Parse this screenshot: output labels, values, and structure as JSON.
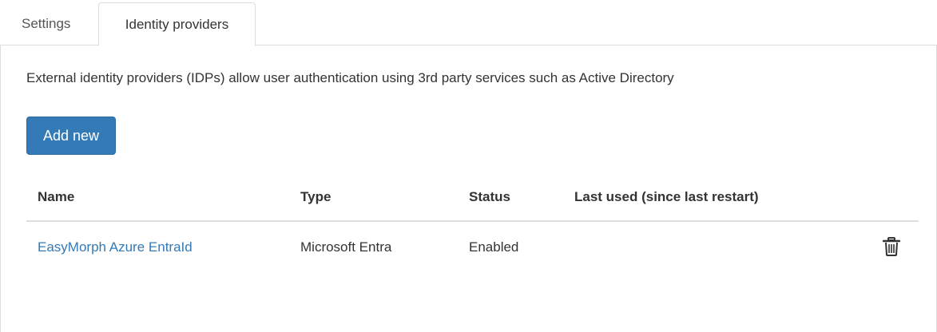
{
  "tabs": [
    {
      "label": "Settings",
      "active": false
    },
    {
      "label": "Identity providers",
      "active": true
    }
  ],
  "panel": {
    "description": "External identity providers (IDPs) allow user authentication using 3rd party services such as Active Directory",
    "add_button_label": "Add new",
    "accent_color": "#337ab7"
  },
  "table": {
    "columns": [
      "Name",
      "Type",
      "Status",
      "Last used (since last restart)"
    ],
    "rows": [
      {
        "name": "EasyMorph Azure EntraId",
        "type": "Microsoft Entra",
        "status": "Enabled",
        "last_used": "",
        "action_icon": "trash-icon"
      }
    ]
  }
}
